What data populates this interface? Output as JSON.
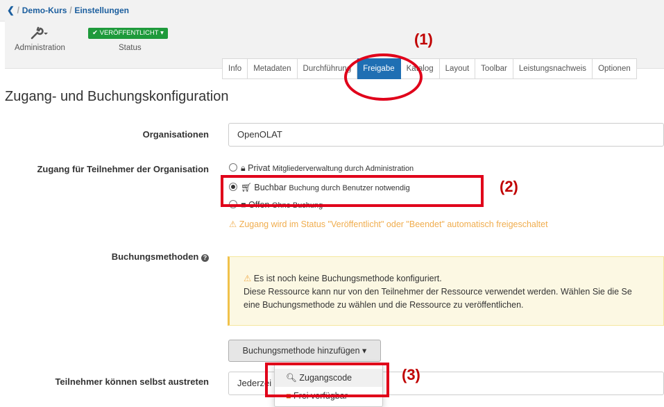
{
  "breadcrumb": {
    "items": [
      "Demo-Kurs",
      "Einstellungen"
    ],
    "separator": "/"
  },
  "header": {
    "admin_label": "Administration",
    "status_badge": "VERÖFFENTLICHT",
    "status_label": "Status"
  },
  "tabs": [
    "Info",
    "Metadaten",
    "Durchführung",
    "Freigabe",
    "Katalog",
    "Layout",
    "Toolbar",
    "Leistungsnachweis",
    "Optionen"
  ],
  "active_tab": "Freigabe",
  "page_title": "Zugang- und Buchungskonfiguration",
  "form": {
    "organisations_label": "Organisationen",
    "organisations_value": "OpenOLAT",
    "access_label": "Zugang für Teilnehmer der Organisation",
    "options": [
      {
        "title": "Privat",
        "desc": "Mitgliederverwaltung durch Administration",
        "selected": false,
        "icon": "lock-icon"
      },
      {
        "title": "Buchbar",
        "desc": "Buchung durch Benutzer notwendig",
        "selected": true,
        "icon": "cart-icon"
      },
      {
        "title": "Offen",
        "desc": "Ohne Buchung",
        "selected": false,
        "icon": "door-icon"
      }
    ],
    "access_warning": "Zugang wird im Status \"Veröffentlicht\" oder \"Beendet\" automatisch freigeschaltet",
    "booking_methods_label": "Buchungsmethoden",
    "alert_line1": "Es ist noch keine Buchungsmethode konfiguriert.",
    "alert_line2": "Diese Ressource kann nur von den Teilnehmer der Ressource verwendet werden. Wählen Sie die Se",
    "alert_line3": "eine Buchungsmethode zu wählen und die Ressource zu veröffentlichen.",
    "add_method_button": "Buchungsmethode hinzufügen",
    "menu_items": [
      "Zugangscode",
      "Frei verfügbar"
    ],
    "leave_label": "Teilnehmer können selbst austreten",
    "leave_value": "Jederzei"
  },
  "annotations": [
    "(1)",
    "(2)",
    "(3)"
  ],
  "colors": {
    "accent": "#1f6fb3",
    "status_green": "#1e9a3b",
    "warning": "#f0ad4e",
    "annotation_red": "#e0001a"
  }
}
